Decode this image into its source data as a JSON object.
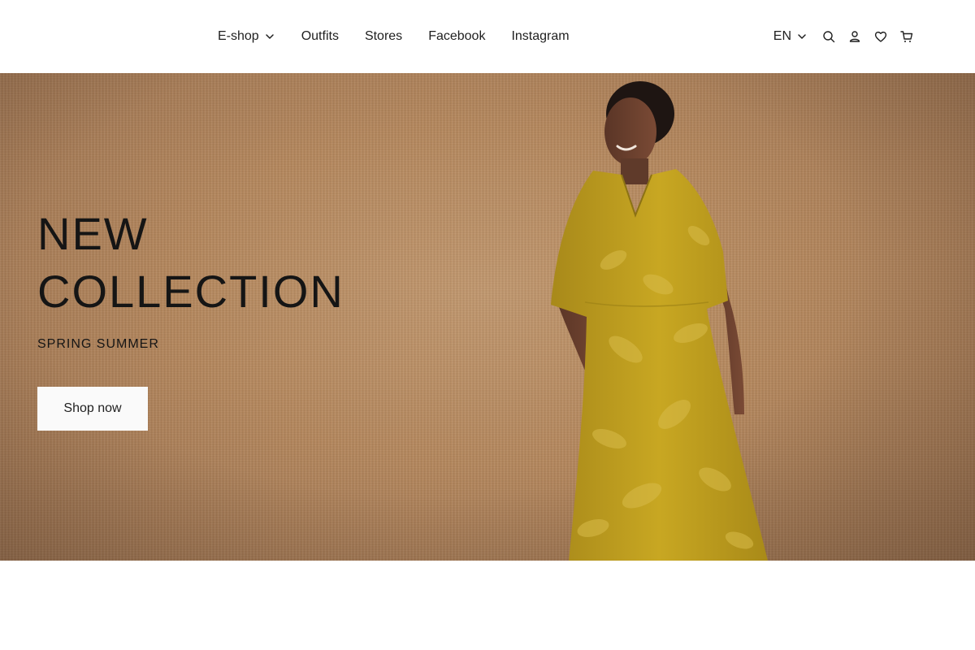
{
  "nav": {
    "items": [
      {
        "label": "E-shop",
        "has_dropdown": true,
        "icon": "chevron-down-icon"
      },
      {
        "label": "Outfits"
      },
      {
        "label": "Stores"
      },
      {
        "label": "Facebook"
      },
      {
        "label": "Instagram"
      }
    ]
  },
  "utilities": {
    "language": "EN",
    "language_icon": "chevron-down-icon",
    "icons": [
      "search-icon",
      "account-icon",
      "wishlist-heart-icon",
      "cart-icon"
    ]
  },
  "hero": {
    "title_line1": "NEW",
    "title_line2": "COLLECTION",
    "subtitle": "SPRING SUMMER",
    "cta_label": "Shop now",
    "colors": {
      "background": "#b7895e",
      "dress": "#c5a41e",
      "button_bg": "#fafafa",
      "text": "#151515"
    }
  }
}
